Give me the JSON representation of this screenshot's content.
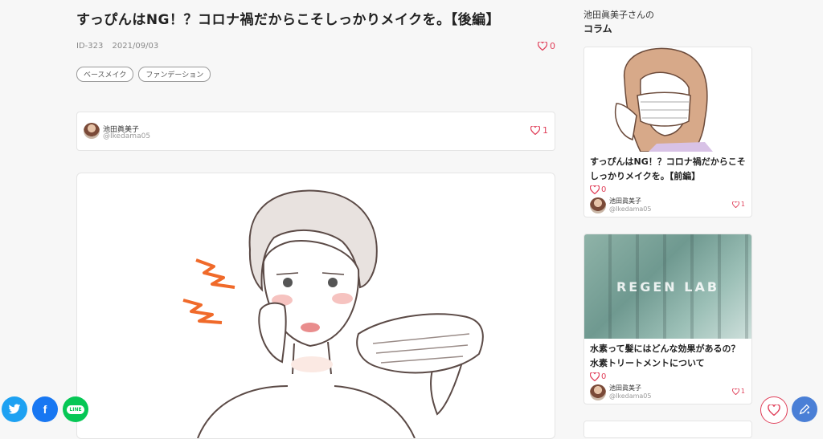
{
  "article": {
    "title": "すっぴんはNG！？コロナ禍だからこそしっかりメイクを。【後編】",
    "id": "ID-323",
    "date": "2021/09/03",
    "likes": "0",
    "tags": [
      "ベースメイク",
      "ファンデーション"
    ]
  },
  "author": {
    "name": "池田眞美子",
    "handle": "@Ikedama05",
    "likes": "1"
  },
  "sidebar": {
    "author_label": "池田眞美子さんの",
    "heading": "コラム",
    "cards": [
      {
        "title": "すっぴんはNG！？コロナ禍だからこそしっかりメイクを。【前編】",
        "likes": "0",
        "author_name": "池田眞美子",
        "author_handle": "@Ikedama05",
        "author_likes": "1"
      },
      {
        "title": "水素って髪にはどんな効果があるの？水素トリートメントについて",
        "likes": "0",
        "author_name": "池田眞美子",
        "author_handle": "@Ikedama05",
        "author_likes": "1",
        "thumb_text": "REGEN LAB"
      }
    ]
  },
  "share": {
    "twitter": "twitter-icon",
    "facebook": "f",
    "line": "LINE"
  },
  "colors": {
    "accent": "#e0405a",
    "twitter": "#1da1f2",
    "facebook": "#1877f2",
    "line": "#06c755",
    "fab_edit": "#4a7fd6"
  }
}
